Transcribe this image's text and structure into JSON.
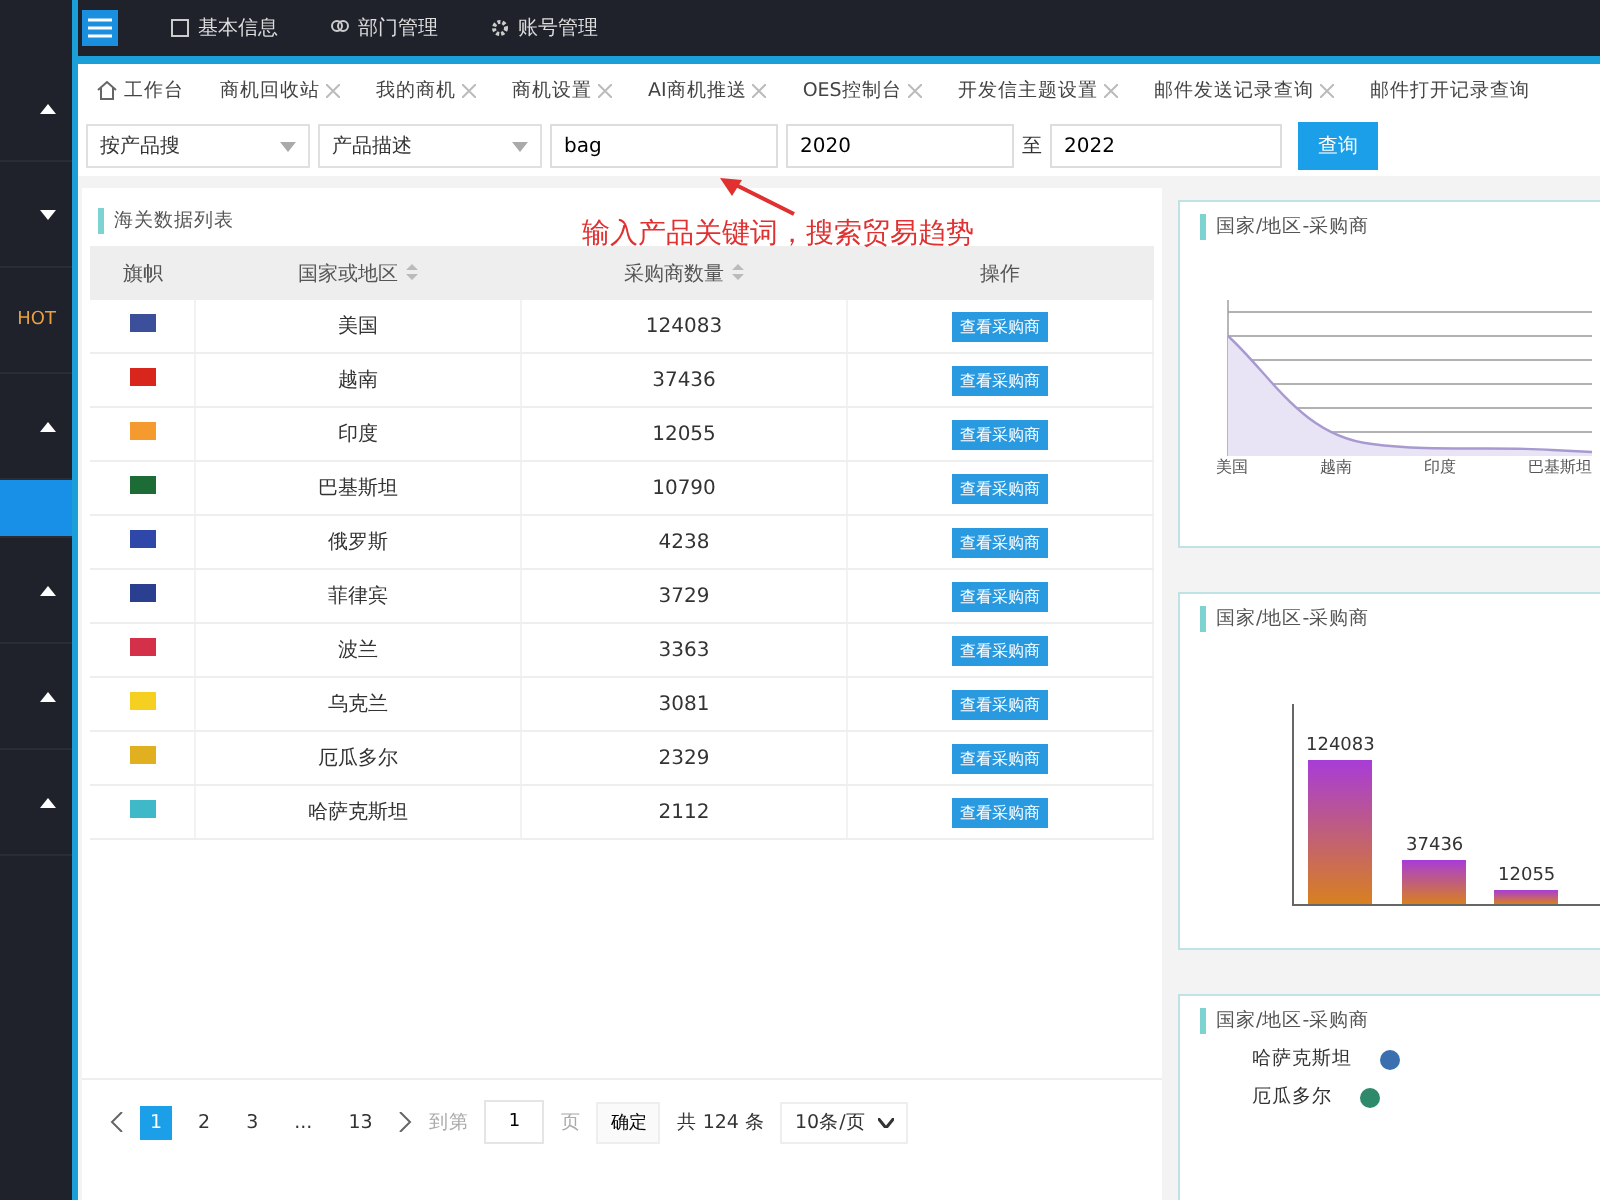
{
  "sidebar": {
    "items": [
      {
        "kind": "arrow",
        "expanded": true,
        "selected": false
      },
      {
        "kind": "arrow",
        "expanded": false,
        "selected": false
      },
      {
        "kind": "hot",
        "label": "HOT",
        "selected": false
      },
      {
        "kind": "arrow",
        "expanded": true,
        "selected": false
      },
      {
        "kind": "plain",
        "selected": true
      },
      {
        "kind": "arrow",
        "expanded": true,
        "selected": false
      },
      {
        "kind": "arrow",
        "expanded": true,
        "selected": false
      },
      {
        "kind": "arrow",
        "expanded": true,
        "selected": false
      }
    ]
  },
  "top_nav": [
    {
      "label": "基本信息"
    },
    {
      "label": "部门管理"
    },
    {
      "label": "账号管理"
    }
  ],
  "tabs": [
    {
      "label": "工作台",
      "home": true,
      "closable": false
    },
    {
      "label": "商机回收站",
      "home": false,
      "closable": true
    },
    {
      "label": "我的商机",
      "home": false,
      "closable": true
    },
    {
      "label": "商机设置",
      "home": false,
      "closable": true
    },
    {
      "label": "AI商机推送",
      "home": false,
      "closable": true
    },
    {
      "label": "OES控制台",
      "home": false,
      "closable": true
    },
    {
      "label": "开发信主题设置",
      "home": false,
      "closable": true
    },
    {
      "label": "邮件发送记录查询",
      "home": false,
      "closable": true
    },
    {
      "label": "邮件打开记录查询",
      "home": false,
      "closable": false
    }
  ],
  "filters": {
    "mode": "按产品搜",
    "field": "产品描述",
    "keyword": "bag",
    "year_from": "2020",
    "separator": "至",
    "year_to": "2022",
    "button": "查询"
  },
  "annotation": {
    "text": "输入产品关键词，搜索贸易趋势"
  },
  "table": {
    "title": "海关数据列表",
    "columns": [
      {
        "label": "旗帜",
        "sortable": false
      },
      {
        "label": "国家或地区",
        "sortable": true
      },
      {
        "label": "采购商数量",
        "sortable": true
      },
      {
        "label": "操作",
        "sortable": false
      }
    ],
    "rows": [
      {
        "color": "#3b4f9a",
        "country": "美国",
        "count": "124083",
        "action": "查看采购商"
      },
      {
        "color": "#d8261c",
        "country": "越南",
        "count": "37436",
        "action": "查看采购商"
      },
      {
        "color": "#f59a2e",
        "country": "印度",
        "count": "12055",
        "action": "查看采购商"
      },
      {
        "color": "#1d6b35",
        "country": "巴基斯坦",
        "count": "10790",
        "action": "查看采购商"
      },
      {
        "color": "#2f47a8",
        "country": "俄罗斯",
        "count": "4238",
        "action": "查看采购商"
      },
      {
        "color": "#2a3f8f",
        "country": "菲律宾",
        "count": "3729",
        "action": "查看采购商"
      },
      {
        "color": "#d4304a",
        "country": "波兰",
        "count": "3363",
        "action": "查看采购商"
      },
      {
        "color": "#f5d020",
        "country": "乌克兰",
        "count": "3081",
        "action": "查看采购商"
      },
      {
        "color": "#e0b020",
        "country": "厄瓜多尔",
        "count": "2329",
        "action": "查看采购商"
      },
      {
        "color": "#3fb8c8",
        "country": "哈萨克斯坦",
        "count": "2112",
        "action": "查看采购商"
      }
    ]
  },
  "pagination": {
    "pages": [
      {
        "label": "1",
        "selected": true
      },
      {
        "label": "2",
        "selected": false
      },
      {
        "label": "3",
        "selected": false
      },
      {
        "label": "...",
        "selected": false
      },
      {
        "label": "13",
        "selected": false
      }
    ],
    "goto_label": "到第",
    "goto_value": "1",
    "page_unit": "页",
    "confirm": "确定",
    "total": "共 124 条",
    "page_size": "10条/页"
  },
  "panels": [
    {
      "kind": "line",
      "title": "国家/地区-采购商",
      "x_labels": [
        "美国",
        "越南",
        "印度",
        "巴基斯坦"
      ]
    },
    {
      "kind": "bar",
      "title": "国家/地区-采购商",
      "bar_labels": [
        "124083",
        "37436",
        "12055"
      ]
    },
    {
      "kind": "legend",
      "title": "国家/地区-采购商",
      "items": [
        {
          "label": "哈萨克斯坦",
          "color": "#3a6fb0"
        },
        {
          "label": "厄瓜多尔",
          "color": "#2e8a6a"
        }
      ]
    }
  ]
}
